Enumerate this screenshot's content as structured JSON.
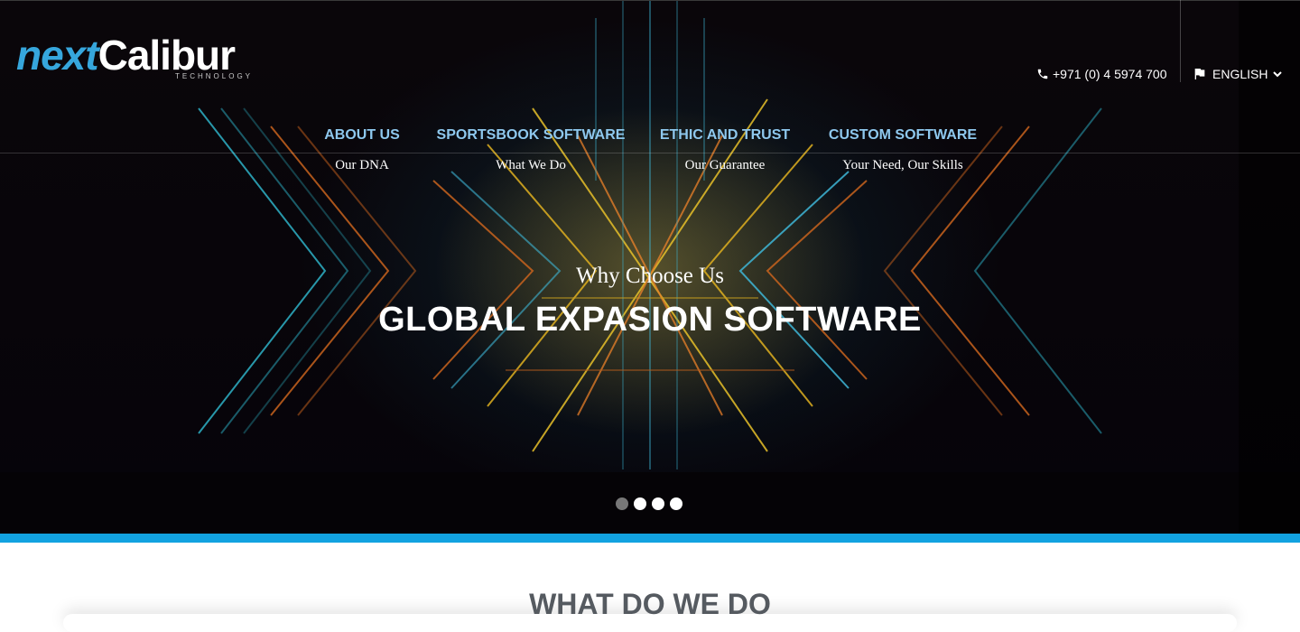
{
  "brand": {
    "logo_part1": "next",
    "logo_part2": "Calibur",
    "logo_sub": "TECHNOLOGY"
  },
  "header": {
    "phone": "+971 (0) 4 5974 700",
    "phone_icon": "phone-icon",
    "language": "ENGLISH",
    "language_icon": "flag-icon",
    "language_chevron": "chevron-down-icon"
  },
  "nav": {
    "items": [
      {
        "title": "ABOUT US",
        "subtitle": "Our DNA"
      },
      {
        "title": "SPORTSBOOK SOFTWARE",
        "subtitle": "What We Do"
      },
      {
        "title": "ETHIC AND TRUST",
        "subtitle": "Our Guarantee"
      },
      {
        "title": "CUSTOM SOFTWARE",
        "subtitle": "Your Need, Our Skills"
      }
    ]
  },
  "hero": {
    "subtitle": "Why Choose Us",
    "title": "GLOBAL EXPASION SOFTWARE",
    "slide_count": 4,
    "active_slide": 1
  },
  "section": {
    "title": "WHAT DO WE DO"
  },
  "colors": {
    "accent_blue": "#12a2e0",
    "nav_title": "#8ec8ee",
    "logo_blue": "#36a6dc",
    "section_title": "#555a60"
  }
}
